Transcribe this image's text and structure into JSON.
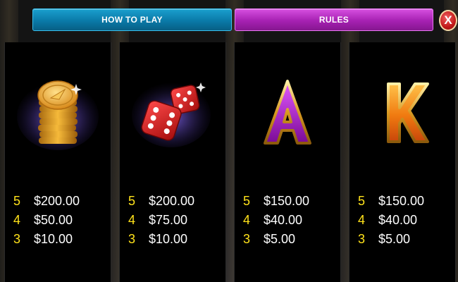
{
  "tabs": {
    "how_to_play": "HOW TO PLAY",
    "rules": "RULES",
    "close": "X"
  },
  "paytable": [
    {
      "symbol": "gold-coin-stack-icon",
      "payouts": [
        {
          "count": "5",
          "value": "$200.00"
        },
        {
          "count": "4",
          "value": "$50.00"
        },
        {
          "count": "3",
          "value": "$10.00"
        }
      ]
    },
    {
      "symbol": "dice-icon",
      "payouts": [
        {
          "count": "5",
          "value": "$200.00"
        },
        {
          "count": "4",
          "value": "$75.00"
        },
        {
          "count": "3",
          "value": "$10.00"
        }
      ]
    },
    {
      "symbol": "letter-a-icon",
      "payouts": [
        {
          "count": "5",
          "value": "$150.00"
        },
        {
          "count": "4",
          "value": "$40.00"
        },
        {
          "count": "3",
          "value": "$5.00"
        }
      ]
    },
    {
      "symbol": "letter-k-icon",
      "payouts": [
        {
          "count": "5",
          "value": "$150.00"
        },
        {
          "count": "4",
          "value": "$40.00"
        },
        {
          "count": "3",
          "value": "$5.00"
        }
      ]
    }
  ],
  "colors": {
    "how_to_play_tab": "#0a7aa8",
    "rules_tab": "#a621b2",
    "count_color": "#ffe21a",
    "value_color": "#ffffff"
  }
}
